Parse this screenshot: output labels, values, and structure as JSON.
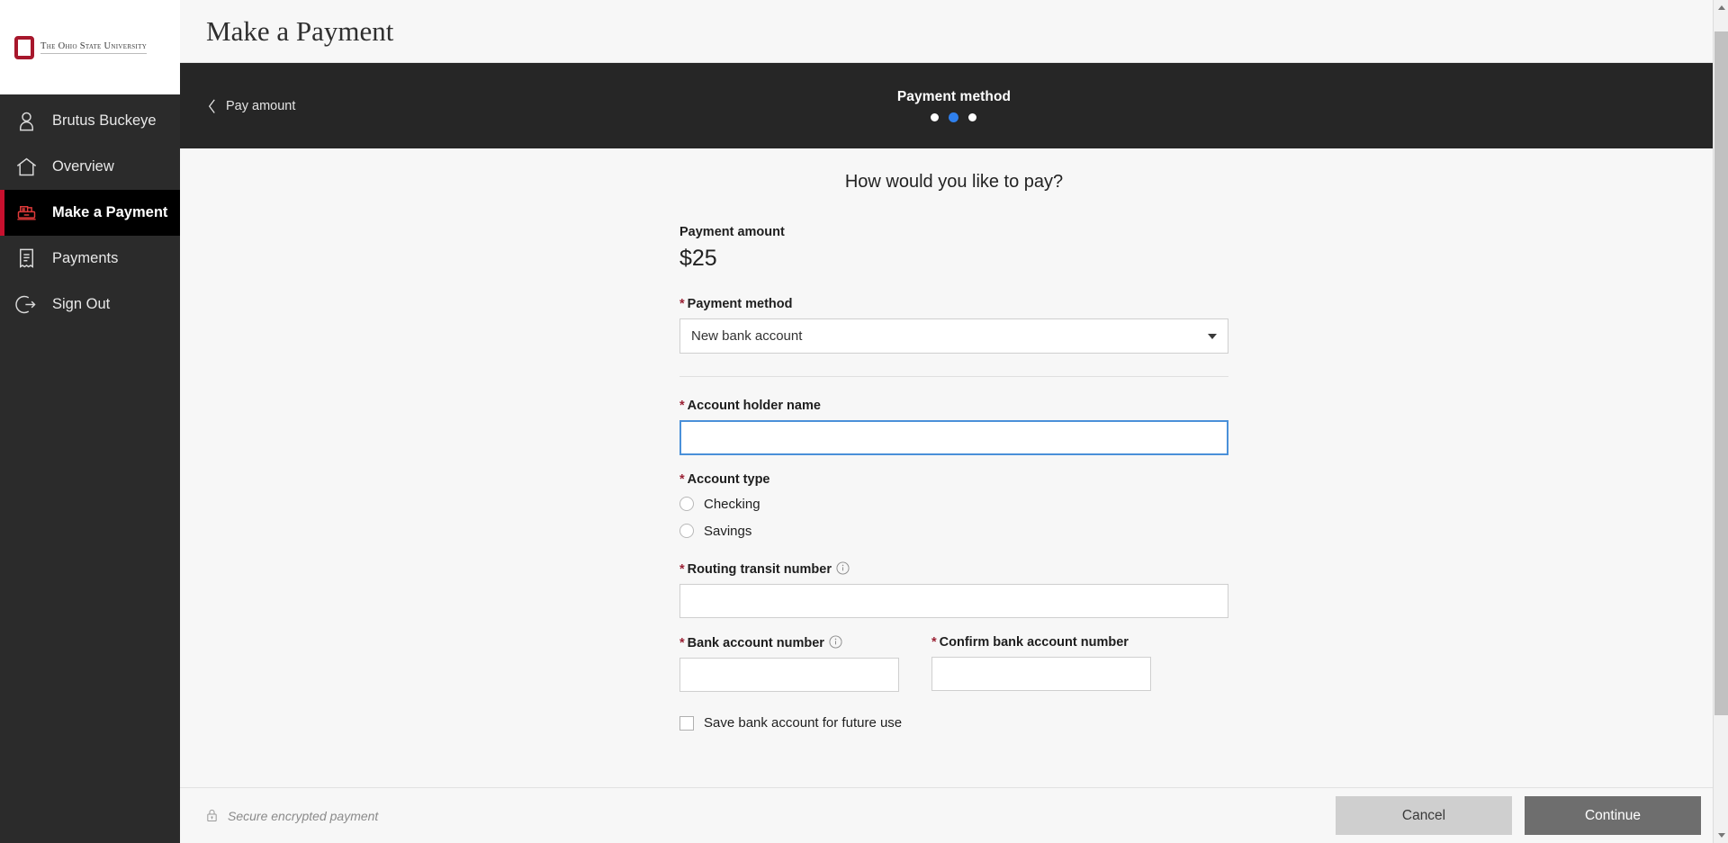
{
  "brand": {
    "logo_mark": "ohio-state-o-icon",
    "logo_text": "The Ohio State University",
    "accent_red": "#c8102e",
    "logo_red": "#a7172c"
  },
  "sidebar": {
    "items": [
      {
        "label": "Brutus Buckeye",
        "icon": "user-icon",
        "active": false
      },
      {
        "label": "Overview",
        "icon": "home-icon",
        "active": false
      },
      {
        "label": "Make a Payment",
        "icon": "cash-register-icon",
        "active": true
      },
      {
        "label": "Payments",
        "icon": "receipt-icon",
        "active": false
      },
      {
        "label": "Sign Out",
        "icon": "sign-out-icon",
        "active": false
      }
    ]
  },
  "header": {
    "title": "Make a Payment"
  },
  "stepper": {
    "back_label": "Pay amount",
    "back_icon": "chevron-left-icon",
    "current_step_label": "Payment method",
    "total_steps": 3,
    "active_step": 2,
    "active_dot_color": "#2f80ed"
  },
  "main": {
    "heading": "How would you like to pay?",
    "payment_amount_label": "Payment amount",
    "payment_amount_value": "$25",
    "payment_method": {
      "label": "Payment method",
      "required_mark": "*",
      "selected_option": "New bank account",
      "caret_icon": "chevron-down-icon"
    },
    "account_holder_name": {
      "label": "Account holder name",
      "required_mark": "*",
      "value": "",
      "placeholder": "",
      "focused": true
    },
    "account_type": {
      "label": "Account type",
      "required_mark": "*",
      "options": [
        {
          "label": "Checking",
          "selected": false
        },
        {
          "label": "Savings",
          "selected": false
        }
      ]
    },
    "routing_transit_number": {
      "label": "Routing transit number",
      "required_mark": "*",
      "info_icon": "info-icon",
      "value": "",
      "placeholder": ""
    },
    "bank_account_number": {
      "label": "Bank account number",
      "required_mark": "*",
      "info_icon": "info-icon",
      "value": "",
      "placeholder": ""
    },
    "confirm_bank_account_number": {
      "label": "Confirm bank account number",
      "required_mark": "*",
      "value": "",
      "placeholder": ""
    },
    "save_account": {
      "label": "Save bank account for future use",
      "checked": false
    }
  },
  "footer": {
    "secure_text": "Secure encrypted payment",
    "lock_icon": "lock-icon",
    "cancel_label": "Cancel",
    "continue_label": "Continue"
  }
}
